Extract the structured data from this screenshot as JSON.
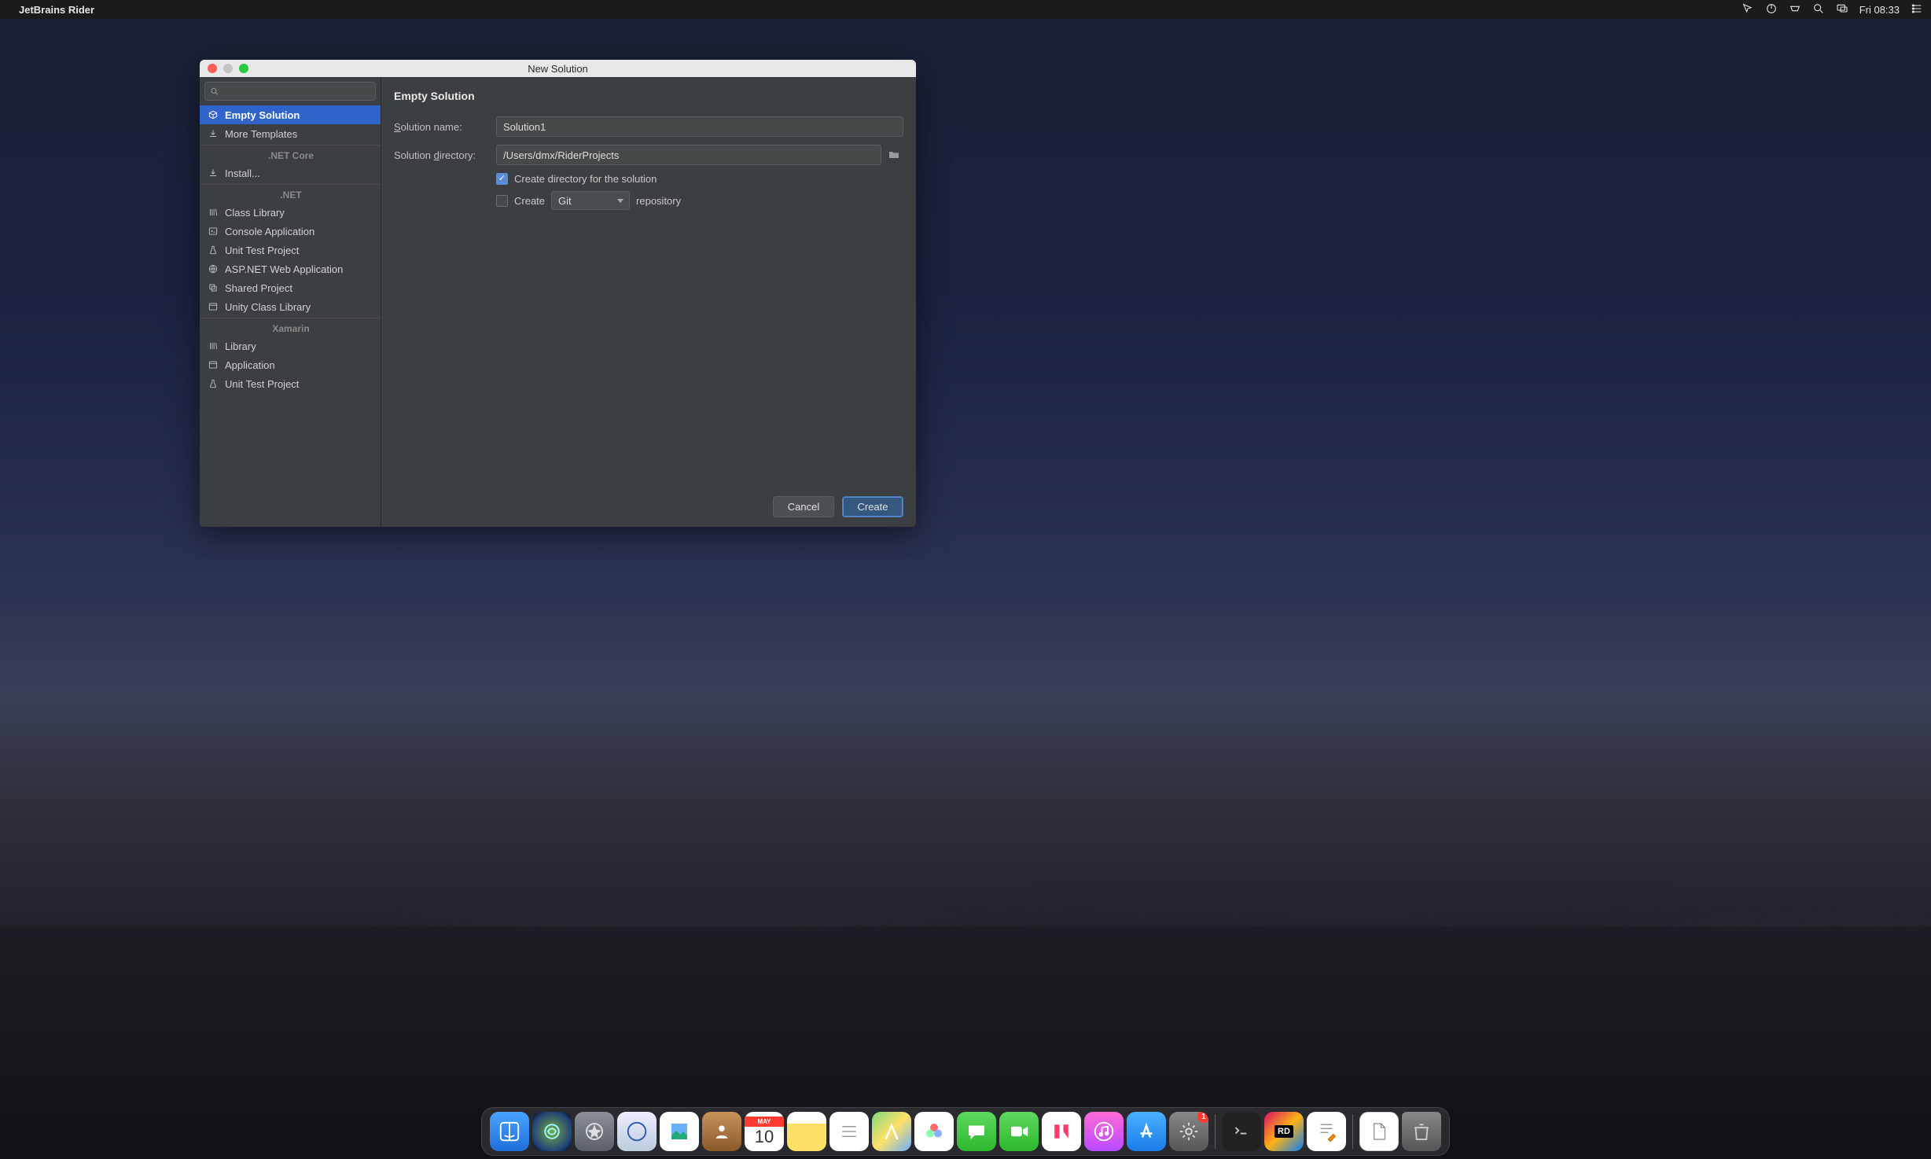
{
  "menubar": {
    "app_name": "JetBrains Rider",
    "clock": "Fri 08:33"
  },
  "dialog": {
    "title": "New Solution",
    "sidebar": {
      "search_placeholder": "",
      "items": [
        {
          "label": "Empty Solution",
          "icon": "box",
          "selected": true
        },
        {
          "label": "More Templates",
          "icon": "download"
        },
        {
          "label": ".NET Core",
          "section": true
        },
        {
          "label": "Install...",
          "icon": "download"
        },
        {
          "label": ".NET",
          "section": true
        },
        {
          "label": "Class Library",
          "icon": "library"
        },
        {
          "label": "Console Application",
          "icon": "console"
        },
        {
          "label": "Unit Test Project",
          "icon": "test"
        },
        {
          "label": "ASP.NET Web Application",
          "icon": "globe"
        },
        {
          "label": "Shared Project",
          "icon": "shared"
        },
        {
          "label": "Unity Class Library",
          "icon": "window"
        },
        {
          "label": "Xamarin",
          "section": true
        },
        {
          "label": "Library",
          "icon": "library"
        },
        {
          "label": "Application",
          "icon": "window"
        },
        {
          "label": "Unit Test Project",
          "icon": "test"
        }
      ]
    },
    "form": {
      "heading": "Empty Solution",
      "name_label": "Solution name:",
      "name_value": "Solution1",
      "dir_label": "Solution directory:",
      "dir_value": "/Users/dmx/RiderProjects",
      "create_dir_label": "Create directory for the solution",
      "create_dir_checked": true,
      "create_repo_prefix": "Create",
      "create_repo_suffix": "repository",
      "vcs_value": "Git",
      "create_repo_checked": false
    },
    "buttons": {
      "cancel": "Cancel",
      "create": "Create"
    }
  },
  "dock": {
    "calendar_month": "MAY",
    "calendar_day": "10",
    "rider_label": "RD",
    "badge_preferences": "1"
  }
}
